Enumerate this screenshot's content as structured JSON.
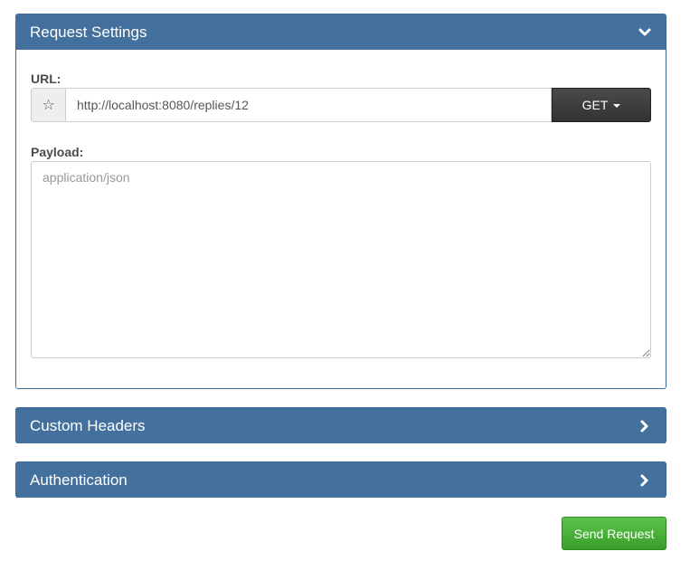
{
  "request_settings": {
    "title": "Request Settings",
    "url_label": "URL:",
    "url_value": "http://localhost:8080/replies/12",
    "method": "GET",
    "payload_label": "Payload:",
    "payload_placeholder": "application/json",
    "payload_value": "",
    "expanded": true
  },
  "custom_headers": {
    "title": "Custom Headers",
    "expanded": false
  },
  "authentication": {
    "title": "Authentication",
    "expanded": false
  },
  "actions": {
    "send_label": "Send Request"
  },
  "colors": {
    "panel_header": "#44709d",
    "send_button": "#47b036",
    "method_button": "#3a3a3a"
  },
  "icons": {
    "favorite": "star-icon",
    "expanded": "chevron-down-icon",
    "collapsed": "chevron-right-icon"
  }
}
